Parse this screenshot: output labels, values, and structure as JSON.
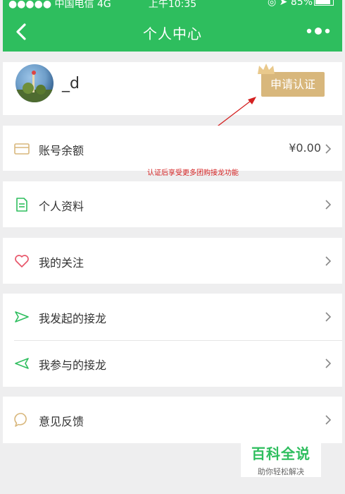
{
  "status_bar": {
    "carrier": "●●●●● 中国电信  4G",
    "time": "上午10:35",
    "battery": "85%"
  },
  "nav": {
    "title": "个人中心"
  },
  "profile": {
    "username": "_d",
    "apply_button": "申请认证"
  },
  "annotation": "认证后享受更多团购接龙功能",
  "menu": {
    "balance": {
      "label": "账号余额",
      "value": "¥0.00"
    },
    "profile_info": {
      "label": "个人资料"
    },
    "following": {
      "label": "我的关注"
    },
    "initiated": {
      "label": "我发起的接龙"
    },
    "participated": {
      "label": "我参与的接龙"
    },
    "feedback": {
      "label": "意见反馈"
    }
  },
  "watermark": {
    "title": "百科全说",
    "subtitle": "助你轻松解决"
  },
  "colors": {
    "brand_green": "#2ebe5e",
    "gold": "#d8b77c",
    "annotation_red": "#d42020",
    "heart_red": "#e8566a"
  }
}
